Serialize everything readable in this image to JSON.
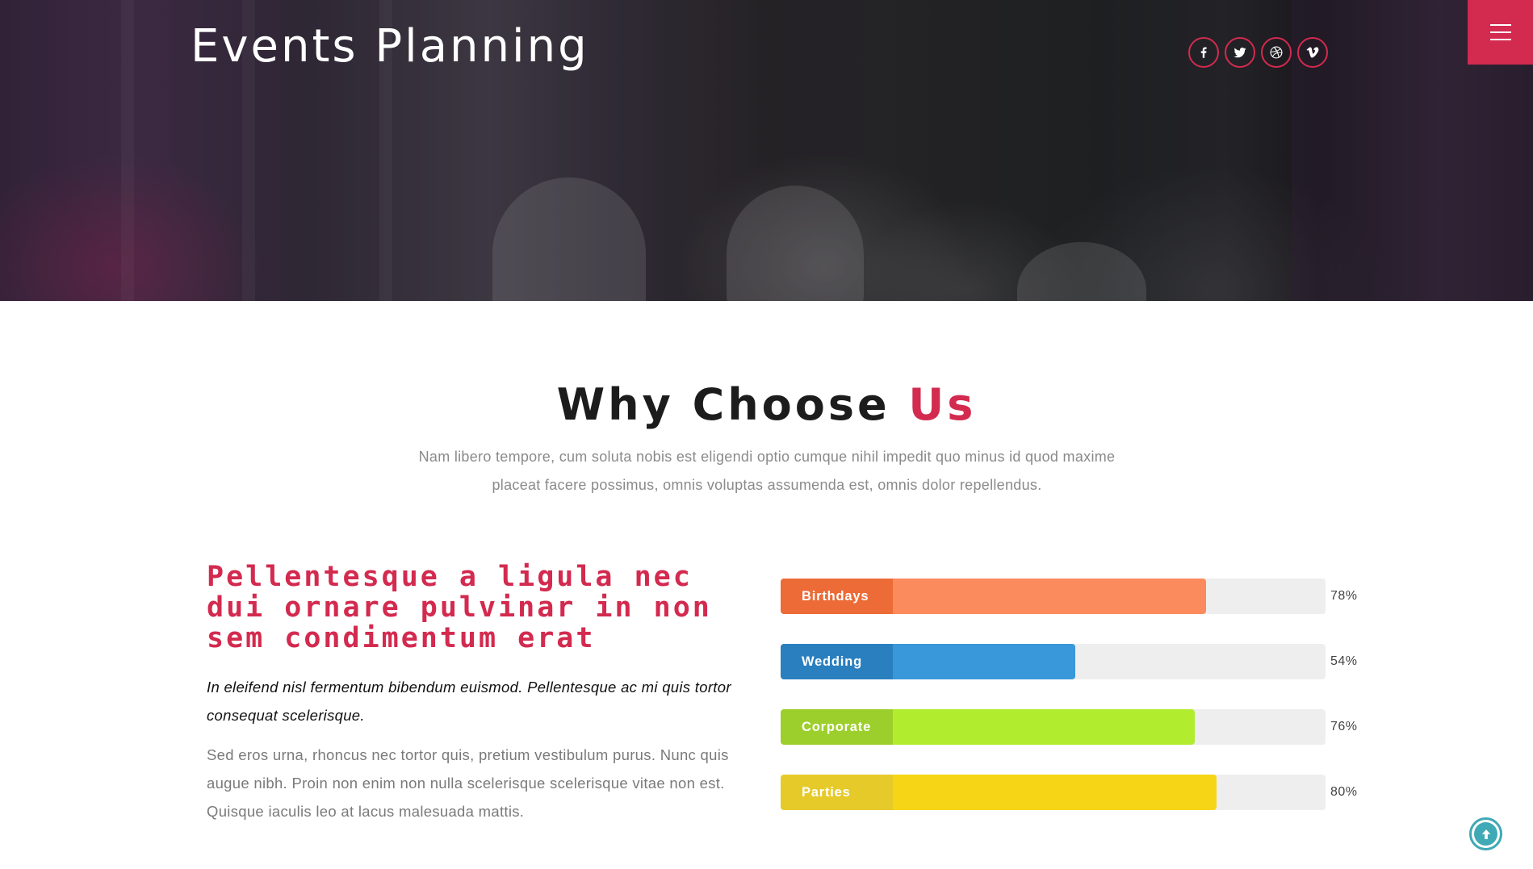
{
  "header": {
    "site_title": "Events Planning",
    "social": [
      {
        "icon": "facebook-icon"
      },
      {
        "icon": "twitter-icon"
      },
      {
        "icon": "dribbble-icon"
      },
      {
        "icon": "vimeo-icon"
      }
    ],
    "menu_icon": "hamburger-icon"
  },
  "why": {
    "title_main": "Why Choose",
    "title_accent": "Us",
    "subtitle": "Nam libero tempore, cum soluta nobis est eligendi optio cumque nihil impedit quo minus id quod maxime placeat facere possimus, omnis voluptas assumenda est, omnis dolor repellendus.",
    "heading": "Pellentesque a ligula nec dui ornare pulvinar in non sem condimentum erat",
    "italic_text": "In eleifend nisl fermentum bibendum euismod. Pellentesque ac mi quis tortor consequat scelerisque.",
    "body_text": "Sed eros urna, rhoncus nec tortor quis, pretium vestibulum purus. Nunc quis augue nibh. Proin non enim non nulla scelerisque scelerisque vitae non est. Quisque iaculis leo at lacus malesuada mattis."
  },
  "skills": [
    {
      "label": "Birthdays",
      "percent_text": "78%",
      "value": 0.78,
      "label_color": "#ec6b37",
      "fill_color": "#fb8a5c"
    },
    {
      "label": "Wedding",
      "percent_text": "54%",
      "value": 0.54,
      "label_color": "#2a7fbf",
      "fill_color": "#3898d9"
    },
    {
      "label": "Corporate",
      "percent_text": "76%",
      "value": 0.76,
      "label_color": "#9dcf2c",
      "fill_color": "#b2ec2f"
    },
    {
      "label": "Parties",
      "percent_text": "80%",
      "value": 0.8,
      "label_color": "#e6ca2a",
      "fill_color": "#f5d515"
    }
  ],
  "colors": {
    "accent": "#d32a4f",
    "back_to_top": "#3fa9b5"
  },
  "back_to_top_icon": "arrow-up-circle-icon"
}
